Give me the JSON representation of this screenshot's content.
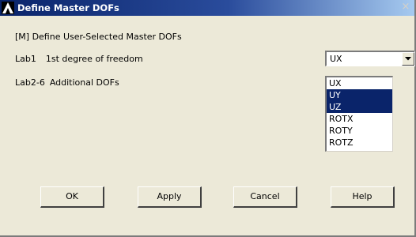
{
  "window": {
    "title": "Define Master DOFs",
    "close_label": "×"
  },
  "form": {
    "header": "[M]  Define User-Selected Master DOFs",
    "lab1": {
      "label": "Lab1",
      "description": "1st degree of freedom",
      "selected_value": "UX"
    },
    "lab2": {
      "label": "Lab2-6",
      "description": "Additional DOFs",
      "options": [
        {
          "label": "UX",
          "selected": false
        },
        {
          "label": "UY",
          "selected": true
        },
        {
          "label": "UZ",
          "selected": true
        },
        {
          "label": "ROTX",
          "selected": false
        },
        {
          "label": "ROTY",
          "selected": false
        },
        {
          "label": "ROTZ",
          "selected": false
        }
      ]
    }
  },
  "buttons": {
    "ok": "OK",
    "apply": "Apply",
    "cancel": "Cancel",
    "help": "Help"
  },
  "colors": {
    "titlebar_start": "#0a246a",
    "titlebar_end": "#a6caf0",
    "selection": "#0a246a",
    "dialog_bg": "#ece9d8"
  },
  "icons": {
    "app": "ansys-logo-icon",
    "close": "close-icon",
    "dropdown": "chevron-down-icon"
  }
}
